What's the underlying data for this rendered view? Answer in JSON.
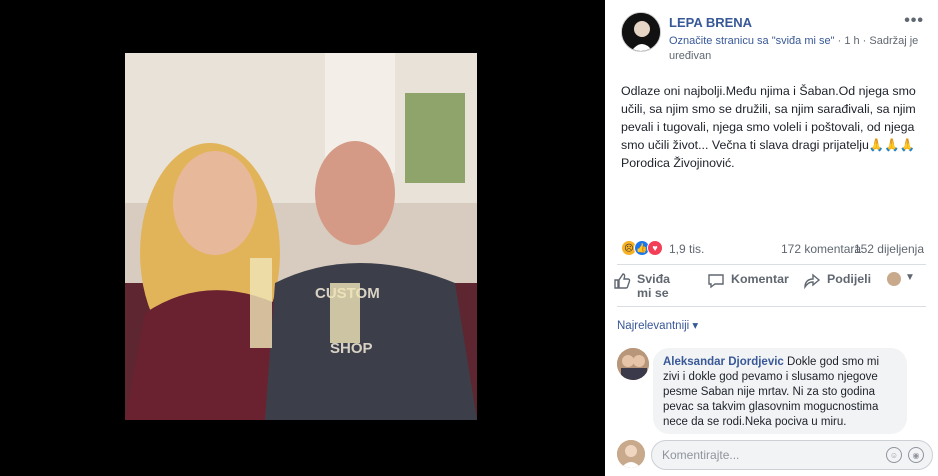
{
  "post": {
    "page_name": "LEPA BRENA",
    "like_prompt": "Označite stranicu sa \"sviđa mi se\"",
    "meta": " · 1 h · Sadržaj je uređivan",
    "more_label": "•••",
    "text": "Odlaze oni najbolji.Među njima i Šaban.Od njega smo učili, sa njim smo se družili, sa njim sarađivali, sa njim pevali i tugovali, njega smo voleli i poštovali, od njega smo učili život... Večna ti slava dragi prijatelju🙏🙏🙏Porodica Živojinović."
  },
  "reactions": {
    "count": "1,9 tis.",
    "comments": "172 komentara",
    "shares": "152 dijeljenja",
    "icons": [
      "sad-icon",
      "like-icon",
      "love-icon"
    ]
  },
  "actions": {
    "like": "Sviđa mi se",
    "comment": "Komentar",
    "share": "Podijeli"
  },
  "comments": {
    "sort_label": "Najrelevantniji ▾",
    "items": [
      {
        "author": "Aleksandar Djordjevic",
        "text": " Dokle god smo mi zivi i dokle god pevamo i slusamo njegove pesme Saban nije mrtav. Ni za sto godina pevac sa takvim glasovnim mogucnostima nece da se rodi.Neka pociva u miru."
      }
    ],
    "input_placeholder": "Komentirajte..."
  },
  "colors": {
    "link": "#385898",
    "bubble": "#f2f3f5"
  }
}
